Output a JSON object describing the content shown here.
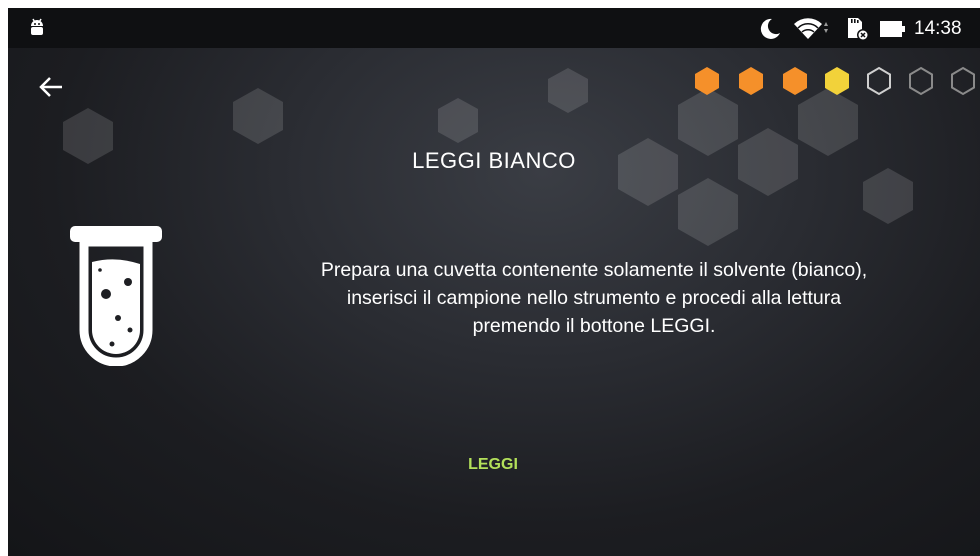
{
  "status_bar": {
    "time": "14:38",
    "icons": [
      "android-icon",
      "moon-icon",
      "wifi-icon",
      "sd-card-icon",
      "battery-icon"
    ]
  },
  "header": {
    "back_icon": "arrow-left-icon",
    "progress": {
      "total_steps": 7,
      "steps": [
        {
          "state": "completed",
          "color": "#f5902a"
        },
        {
          "state": "completed",
          "color": "#f5902a"
        },
        {
          "state": "completed",
          "color": "#f5902a"
        },
        {
          "state": "current",
          "color": "#f2d23a"
        },
        {
          "state": "pending",
          "color": "#cfcfcf"
        },
        {
          "state": "pending",
          "color": "#8a8a8a"
        },
        {
          "state": "pending",
          "color": "#8a8a8a"
        }
      ]
    }
  },
  "main": {
    "title": "LEGGI BIANCO",
    "icon": "test-tube-icon",
    "instructions": [
      "Prepara una cuvetta contenente solamente il solvente (bianco),",
      "inserisci il campione nello strumento e procedi alla lettura",
      "premendo il bottone LEGGI."
    ],
    "read_button_label": "LEGGI"
  },
  "colors": {
    "accent": "#b3e05a",
    "step_done": "#f5902a",
    "step_current": "#f2d23a"
  }
}
